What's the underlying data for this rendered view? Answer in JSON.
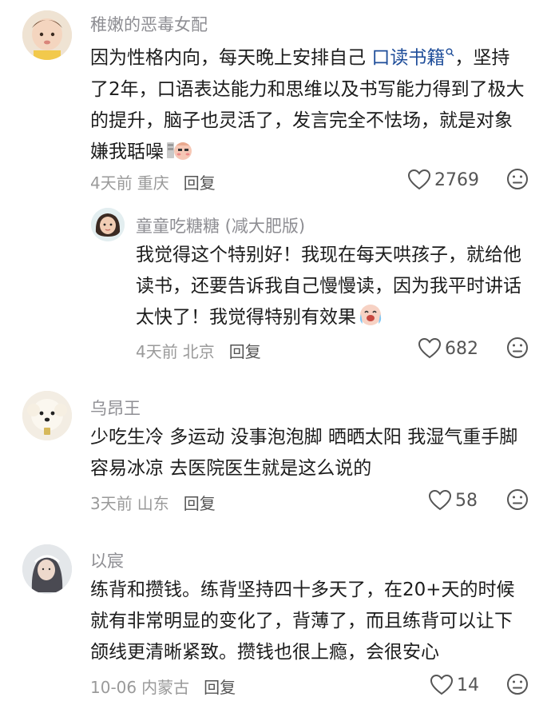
{
  "comments": [
    {
      "username": "稚嫩的恶毒女配",
      "text_before": "因为性格内向，每天晚上安排自己 ",
      "keyword": "口读书籍",
      "text_after": "，坚持了2年，口语表达能力和思维以及书写能力得到了极大的提升，脑子也灵活了，发言完全不怯场，就是对象嫌我聒噪",
      "time": "4天前",
      "location": "重庆",
      "reply_label": "回复",
      "likes": "2769",
      "emoji_icon": "shy-face-emoji-icon"
    },
    {
      "username": "童童吃糖糖 (减大肥版)",
      "text": "我觉得这个特别好！我现在每天哄孩子，就给他读书，还要告诉我自己慢慢读，因为我平时讲话太快了！我觉得特别有效果",
      "time": "4天前",
      "location": "北京",
      "reply_label": "回复",
      "likes": "682",
      "emoji_icon": "crying-laughing-emoji-icon"
    },
    {
      "username": "乌昂王",
      "text": "少吃生冷 多运动 没事泡泡脚 晒晒太阳 我湿气重手脚容易冰凉 去医院医生就是这么说的",
      "time": "3天前",
      "location": "山东",
      "reply_label": "回复",
      "likes": "58"
    },
    {
      "username": "以宸",
      "text": "练背和攒钱。练背坚持四十多天了，在20+天的时候就有非常明显的变化了，背薄了，而且练背可以让下颌线更清晰紧致。攒钱也很上瘾，会很安心",
      "time": "10-06",
      "location": "内蒙古",
      "reply_label": "回复",
      "likes": "14"
    }
  ]
}
